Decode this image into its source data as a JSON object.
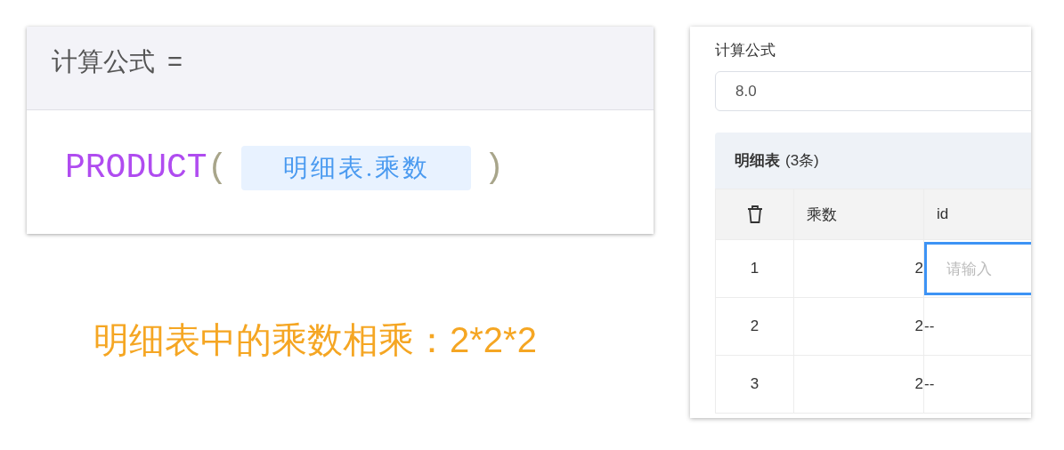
{
  "formula_card": {
    "title": "计算公式",
    "equals": "=",
    "function": "PRODUCT",
    "open_paren": "(",
    "field_token": "明细表.乘数",
    "close_paren": ")"
  },
  "caption": "明细表中的乘数相乘：2*2*2",
  "form_panel": {
    "field_label": "计算公式",
    "field_value": "8.0",
    "subtable": {
      "title": "明细表",
      "count": "(3条)",
      "columns": [
        {
          "kind": "delete"
        },
        {
          "kind": "text",
          "label": "乘数"
        },
        {
          "kind": "text",
          "label": "id"
        }
      ],
      "rows": [
        {
          "index": "1",
          "multiplier": "2",
          "id_cell": {
            "kind": "input",
            "placeholder": "请输入",
            "focused": true
          }
        },
        {
          "index": "2",
          "multiplier": "2",
          "id_cell": {
            "kind": "text",
            "text": "--"
          }
        },
        {
          "index": "3",
          "multiplier": "2",
          "id_cell": {
            "kind": "text",
            "text": "--"
          }
        }
      ]
    }
  }
}
